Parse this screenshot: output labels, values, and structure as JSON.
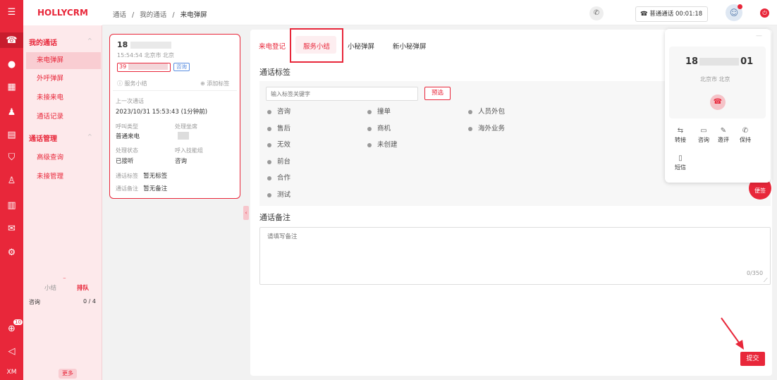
{
  "app": {
    "brand": "HOLLYCRM",
    "rail_footer": "XM",
    "notification_count": "10"
  },
  "header": {
    "breadcrumb": [
      "通话",
      "我的通话",
      "来电弹屏"
    ],
    "separator": "/",
    "call_status": "普通通话 00:01:18"
  },
  "sidebar": {
    "groups": [
      {
        "label": "我的通话",
        "items": [
          "来电弹屏",
          "外呼弹屏",
          "未接来电",
          "通话记录"
        ]
      },
      {
        "label": "通话管理",
        "items": [
          "高级查询",
          "未接管理"
        ]
      }
    ],
    "summary_tab": "小结",
    "queue_tab": "排队",
    "stat_label": "咨询",
    "stat_value": "0 / 4",
    "more": "更多"
  },
  "card": {
    "phone": "18",
    "time_location": "15:54:54 北京市 北京",
    "id_prefix": "39",
    "badge": "咨询",
    "service_summary": "服务小结",
    "add_tag": "添加标签",
    "last_call_label": "上一次通话",
    "last_call_time": "2023/10/31 15:53:43 (1分钟前)",
    "call_type_label": "呼叫类型",
    "call_type": "普通来电",
    "agent_label": "处理坐席",
    "status_label": "处理状态",
    "status": "已接听",
    "skill_label": "呼入技能组",
    "skill": "咨询",
    "tag_label": "通话标签",
    "tag_value": "暂无标签",
    "note_label": "通话备注",
    "note_value": "暂无备注"
  },
  "tabs": [
    "来电登记",
    "服务小结",
    "小秘弹屏",
    "新小秘弹屏"
  ],
  "active_tab": "服务小结",
  "tags_section": {
    "title": "通话标签",
    "search_placeholder": "输入标签关键字",
    "preselect_button": "预选",
    "col1": [
      "咨询",
      "售后",
      "无效",
      "前台",
      "合作",
      "测试"
    ],
    "col2": [
      "撞单",
      "商机",
      "未创建"
    ],
    "col3": [
      "人员外包",
      "海外业务"
    ]
  },
  "notes_section": {
    "title": "通话备注",
    "placeholder": "请填写备注",
    "counter": "0/350"
  },
  "submit": "提交",
  "sticky_note": "便签",
  "phone_panel": {
    "number_prefix": "18",
    "number_suffix": "01",
    "location": "北京市 北京",
    "actions": [
      "转接",
      "咨询",
      "邀评",
      "保持",
      "短信"
    ]
  },
  "colors": {
    "primary": "#e8273a",
    "sidebar_bg": "#fde9eb"
  }
}
